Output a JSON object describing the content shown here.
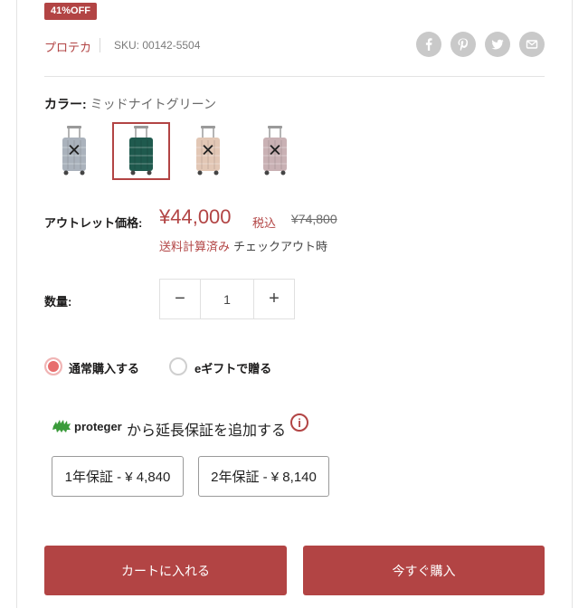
{
  "badge": "41%OFF",
  "vendor": "プロテカ",
  "sku": "SKU: 00142-5504",
  "share": [
    {
      "icon": "facebook-icon"
    },
    {
      "icon": "pinterest-icon"
    },
    {
      "icon": "twitter-icon"
    },
    {
      "icon": "email-icon"
    }
  ],
  "color": {
    "label": "カラー:",
    "value": "ミッドナイトグリーン",
    "swatches": [
      {
        "name": "silver",
        "body": "#aab2bc",
        "sold_out": true
      },
      {
        "name": "midnight-green",
        "body": "#1f5a4e",
        "sold_out": false,
        "selected": true
      },
      {
        "name": "champagne",
        "body": "#e2c7b5",
        "sold_out": true
      },
      {
        "name": "rose",
        "body": "#c9b1b4",
        "sold_out": true
      }
    ]
  },
  "price": {
    "label": "アウトレット価格:",
    "current": "¥44,000",
    "tax": "税込",
    "compare": "¥74,800",
    "shipping_link": "送料計算済み",
    "shipping_text": "チェックアウト時"
  },
  "quantity": {
    "label": "数量:",
    "value": "1",
    "minus": "−",
    "plus": "+"
  },
  "purchase_options": [
    {
      "label": "通常購入する",
      "selected": true
    },
    {
      "label": "eギフトで贈る",
      "selected": false
    }
  ],
  "protection": {
    "logo_text": "proteger",
    "text": "から延長保証を追加する",
    "info": "i"
  },
  "warranty_options": [
    "1年保証 - ¥ 4,840",
    "2年保証 - ¥ 8,140"
  ],
  "actions": {
    "add_to_cart": "カートに入れる",
    "buy_now": "今すぐ購入"
  },
  "colors": {
    "accent": "#b24444"
  }
}
